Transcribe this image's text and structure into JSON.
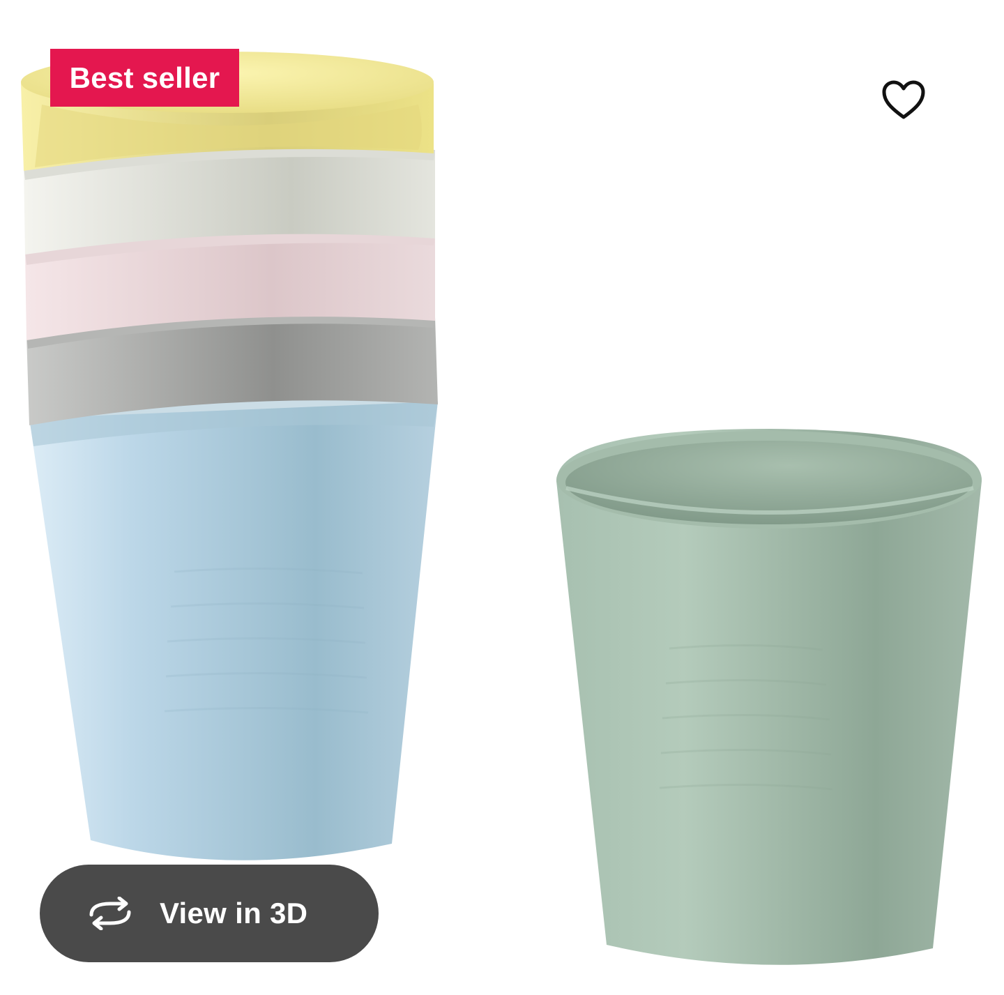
{
  "badge": {
    "label": "Best seller",
    "color": "#e4174f"
  },
  "favorite": {
    "icon": "heart-outline-icon"
  },
  "view_3d": {
    "label": "View in 3D",
    "icon": "rotate-3d-icon"
  },
  "product_image": {
    "cups_stack_colors": [
      "#f3e98f",
      "#eeeee6",
      "#f1dfe2",
      "#a7a9a6",
      "#b7d3e2"
    ],
    "single_cup_color": "#9fb8a8"
  }
}
